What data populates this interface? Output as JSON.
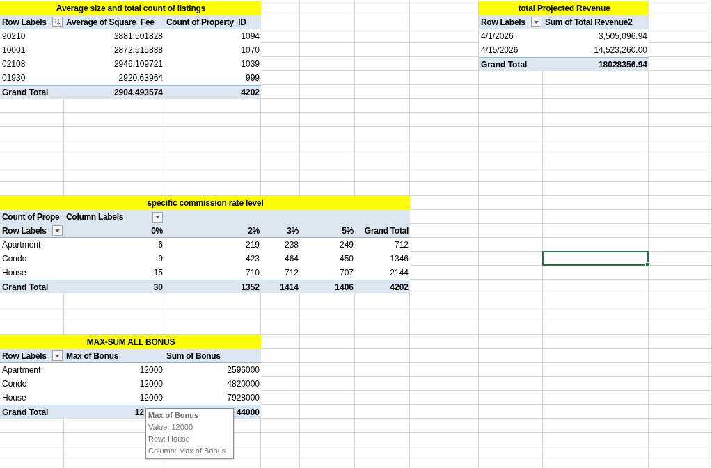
{
  "sheet": {
    "pivots": [
      {
        "title": "Average size and total count of listings",
        "header_rows": [
          [
            {
              "text": "Row Labels",
              "filter": {
                "kind": "sort"
              }
            },
            {
              "text": "Average of Square_Fee"
            },
            {
              "text": "Count of Property_ID"
            }
          ]
        ],
        "rows": [
          [
            "90210",
            "2881.501828",
            "1094"
          ],
          [
            "10001",
            "2872.515888",
            "1070"
          ],
          [
            "02108",
            "2946.109721",
            "1039"
          ],
          [
            "01930",
            "2920.63964",
            "999"
          ]
        ],
        "total": [
          "Grand Total",
          "2904.493574",
          "4202"
        ]
      },
      {
        "title": "total Projected Revenue",
        "header_rows": [
          [
            {
              "text": "Row Labels",
              "filter": {
                "kind": "dropdown"
              }
            },
            {
              "text": "Sum of Total Revenue2"
            }
          ]
        ],
        "rows": [
          [
            "4/1/2026",
            "3,505,096.94"
          ],
          [
            "4/15/2026",
            "14,523,260.00"
          ]
        ],
        "total": [
          "Grand Total",
          "18028356.94"
        ]
      },
      {
        "title": "specific commission rate level",
        "header_rows": [
          [
            {
              "text": "Count of Prope"
            },
            {
              "text": "Column Labels",
              "filter": {
                "kind": "dropdown"
              }
            },
            null,
            null,
            null,
            null
          ],
          [
            {
              "text": "Row Labels",
              "filter": {
                "kind": "dropdown"
              }
            },
            {
              "text": "0%",
              "kind": "number"
            },
            {
              "text": "2%",
              "kind": "number"
            },
            {
              "text": "3%",
              "kind": "number"
            },
            {
              "text": "5%",
              "kind": "number"
            },
            {
              "text": "Grand Total",
              "kind": "number"
            }
          ]
        ],
        "rows": [
          [
            "Apartment",
            "6",
            "219",
            "238",
            "249",
            "712"
          ],
          [
            "Condo",
            "9",
            "423",
            "464",
            "450",
            "1346"
          ],
          [
            "House",
            "15",
            "710",
            "712",
            "707",
            "2144"
          ]
        ],
        "total": [
          "Grand Total",
          "30",
          "1352",
          "1414",
          "1406",
          "4202"
        ]
      },
      {
        "title": "MAX-SUM ALL BONUS",
        "header_rows": [
          [
            {
              "text": "Row Labels",
              "filter": {
                "kind": "dropdown"
              }
            },
            {
              "text": "Max of Bonus"
            },
            {
              "text": "Sum of Bonus"
            }
          ]
        ],
        "rows": [
          [
            "Apartment",
            "12000",
            "2596000"
          ],
          [
            "Condo",
            "12000",
            "4820000"
          ],
          [
            "House",
            "12000",
            "7928000"
          ]
        ],
        "total": [
          "Grand Total",
          "12",
          "44000"
        ]
      }
    ],
    "active_cell": {
      "selected": true
    },
    "tooltip": {
      "title": "Max of Bonus",
      "lines": [
        "Value: 12000",
        "Row: House",
        "Column: Max of Bonus"
      ]
    }
  }
}
